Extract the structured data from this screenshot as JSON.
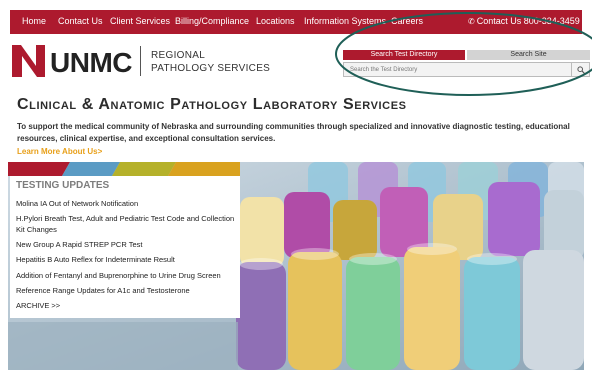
{
  "nav": {
    "items": [
      "Home",
      "Contact Us",
      "Client Services",
      "Billing/Compliance",
      "Locations",
      "Information Systems",
      "Careers"
    ],
    "contact_label": "Contact Us 800-334-3459",
    "contact_icon": "phone-icon"
  },
  "logo": {
    "wordmark": "UNMC",
    "sub_line1": "REGIONAL",
    "sub_line2": "PATHOLOGY SERVICES"
  },
  "search": {
    "tab_directory": "Search Test Directory",
    "tab_site": "Search Site",
    "placeholder": "Search the Test Directory",
    "button_icon": "search-icon"
  },
  "main": {
    "headline": "Clinical & Anatomic Pathology Laboratory Services",
    "tagline": "To support the medical community of Nebraska and surrounding communities through specialized and innovative diagnostic testing, educational resources, clinical expertise, and exceptional consultation services.",
    "learn_more": "Learn More About Us>"
  },
  "updates": {
    "title": "TESTING UPDATES",
    "items": [
      "Molina IA Out of Network Notification",
      "H.Pylori Breath Test, Adult and Pediatric Test Code and Collection Kit Changes",
      "New Group A Rapid STREP PCR Test",
      "Hepatitis B Auto Reflex for Indeterminate Result",
      "Addition of Fentanyl and Buprenorphine to Urine Drug Screen",
      "Reference Range Updates for A1c and Testosterone"
    ],
    "archive": "ARCHIVE >>"
  },
  "colors": {
    "brand_red": "#ad1a2e",
    "accent_orange": "#e8a01a",
    "stripe_red": "#ad1a2e",
    "stripe_blue": "#5b9bc4",
    "stripe_olive": "#b5b12a",
    "stripe_gold": "#d9a21f",
    "annotation_green": "#1f5f57"
  }
}
